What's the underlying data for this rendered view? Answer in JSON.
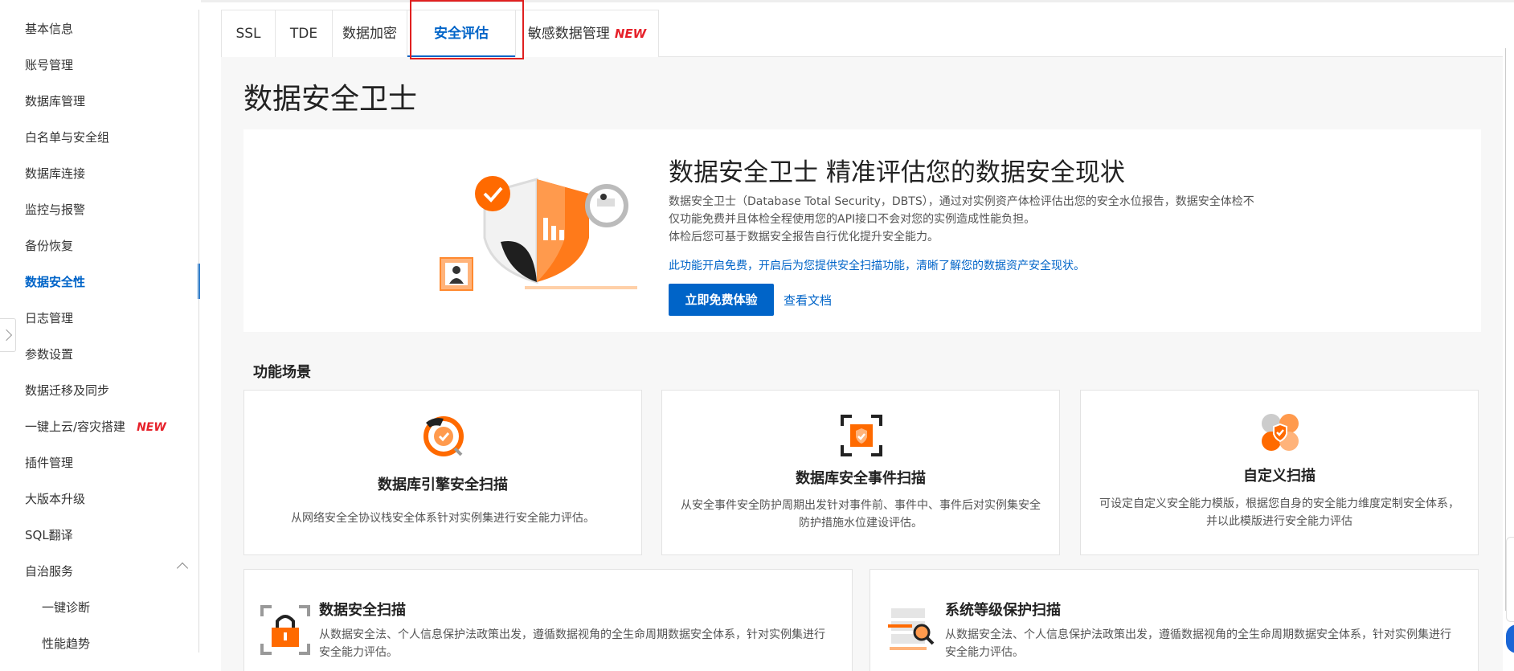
{
  "colors": {
    "accent": "#0064c8",
    "brand_orange": "#ff6a00",
    "new_badge": "#e6212a",
    "highlight_box": "#e02020"
  },
  "sidebar": {
    "items": [
      {
        "label": "基本信息"
      },
      {
        "label": "账号管理"
      },
      {
        "label": "数据库管理"
      },
      {
        "label": "白名单与安全组"
      },
      {
        "label": "数据库连接"
      },
      {
        "label": "监控与报警"
      },
      {
        "label": "备份恢复"
      },
      {
        "label": "数据安全性",
        "active": true
      },
      {
        "label": "日志管理"
      },
      {
        "label": "参数设置"
      },
      {
        "label": "数据迁移及同步"
      },
      {
        "label": "一键上云/容灾搭建",
        "badge": "NEW"
      },
      {
        "label": "插件管理"
      },
      {
        "label": "大版本升级"
      },
      {
        "label": "SQL翻译"
      },
      {
        "label": "自治服务",
        "expanded": true,
        "icon": "chevron-up-icon"
      },
      {
        "label": "一键诊断",
        "sub": true
      },
      {
        "label": "性能趋势",
        "sub": true
      }
    ]
  },
  "tabs": [
    {
      "label": "SSL"
    },
    {
      "label": "TDE"
    },
    {
      "label": "数据加密"
    },
    {
      "label": "安全评估",
      "active": true
    },
    {
      "label": "敏感数据管理",
      "badge": "NEW"
    }
  ],
  "page": {
    "title": "数据安全卫士"
  },
  "hero": {
    "title": "数据安全卫士 精准评估您的数据安全现状",
    "desc_line1": "数据安全卫士（Database Total Security，DBTS），通过对实例资产体检评估出您的安全水位报告，数据安全体检不",
    "desc_line2": "仅功能免费并且体检全程使用您的API接口不会对您的实例造成性能负担。",
    "desc_line3": "体检后您可基于数据安全报告自行优化提升安全能力。",
    "note": "此功能开启免费，开启后为您提供安全扫描功能，清晰了解您的数据资产安全现状。",
    "primary_button": "立即免费体验",
    "doc_link": "查看文档"
  },
  "scenarios": {
    "title": "功能场景",
    "cards": [
      {
        "icon": "engine-scan-icon",
        "title": "数据库引擎安全扫描",
        "desc": "从网络安全全协议栈安全体系针对实例集进行安全能力评估。"
      },
      {
        "icon": "event-scan-icon",
        "title": "数据库安全事件扫描",
        "desc": "从安全事件安全防护周期出发针对事件前、事件中、事件后对实例集安全防护措施水位建设评估。"
      },
      {
        "icon": "custom-scan-icon",
        "title": "自定义扫描",
        "desc": "可设定自定义安全能力模版，根据您自身的安全能力维度定制安全体系，并以此模版进行安全能力评估"
      }
    ],
    "wide_cards": [
      {
        "icon": "data-lock-icon",
        "title": "数据安全扫描",
        "desc": "从数据安全法、个人信息保护法政策出发，遵循数据视角的全生命周期数据安全体系，针对实例集进行安全能力评估。"
      },
      {
        "icon": "level-protection-icon",
        "title": "系统等级保护扫描",
        "desc": "从数据安全法、个人信息保护法政策出发，遵循数据视角的全生命周期数据安全体系，针对实例集进行安全能力评估。"
      }
    ]
  }
}
